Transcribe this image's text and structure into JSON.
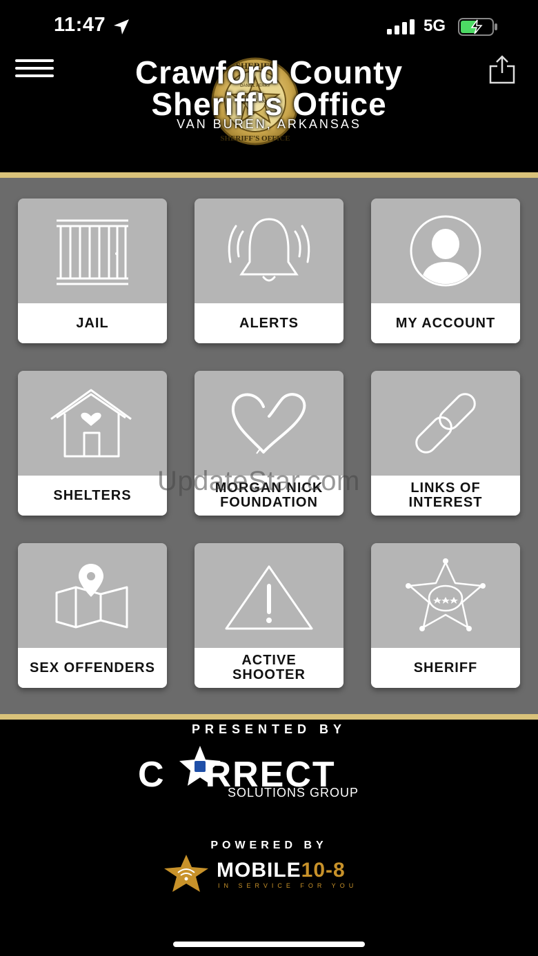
{
  "status_bar": {
    "time": "11:47",
    "network": "5G",
    "icons": [
      "location-arrow-icon",
      "signal-bars-icon",
      "battery-charging-icon"
    ]
  },
  "header": {
    "title_line1": "Crawford County",
    "title_line2": "Sheriff's Office",
    "subtitle": "VAN BUREN, ARKANSAS",
    "badge_text_top": "SHERIFF",
    "badge_text_bottom": "SHERIFF'S OFFICE",
    "badge_name": "DANIEL PERRY",
    "badge_center": "CRAWFORD COUNTY",
    "menu_icon": "hamburger-menu-icon",
    "share_icon": "share-icon"
  },
  "tiles": [
    {
      "label": "JAIL",
      "icon": "jail-bars-icon"
    },
    {
      "label": "ALERTS",
      "icon": "alarm-bell-icon"
    },
    {
      "label": "MY ACCOUNT",
      "icon": "user-avatar-icon"
    },
    {
      "label": "SHELTERS",
      "icon": "house-heart-icon"
    },
    {
      "label_line1": "MORGAN NICK",
      "label_line2": "FOUNDATION",
      "icon": "heart-icon"
    },
    {
      "label_line1": "LINKS OF",
      "label_line2": "INTEREST",
      "icon": "chain-link-icon"
    },
    {
      "label": "SEX OFFENDERS",
      "icon": "map-pin-icon"
    },
    {
      "label_line1": "ACTIVE",
      "label_line2": "SHOOTER",
      "icon": "warning-triangle-icon"
    },
    {
      "label": "SHERIFF",
      "icon": "sheriff-star-icon"
    }
  ],
  "watermark": "UpdateStar.com",
  "footer": {
    "presented_by": "PRESENTED BY",
    "correct_word_left": "C",
    "correct_word_right": "RRECT",
    "correct_sub": "SOLUTIONS GROUP",
    "powered_by": "POWERED BY",
    "mobile_word": "MOBILE",
    "mobile_num": "10-8",
    "mobile_tag": "IN SERVICE FOR YOU"
  },
  "colors": {
    "gold": "#d9c27a",
    "grid_bg": "#6b6b6b",
    "tile_bg": "#b5b5b5",
    "mobile_gold": "#c8922a",
    "correct_blue": "#1f4fa8"
  }
}
